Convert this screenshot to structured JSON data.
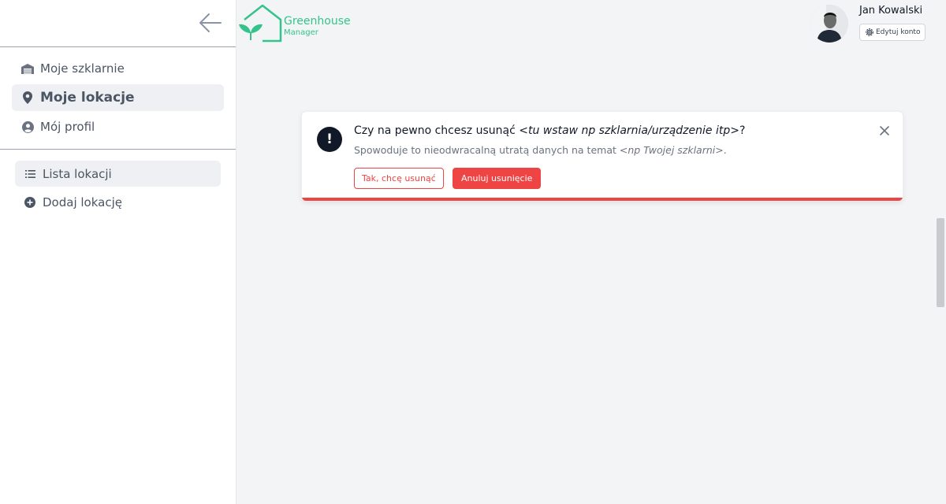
{
  "colors": {
    "brand_green": "#34c48b",
    "danger": "#ef4444",
    "sidebar_active_bg": "#eef0f4",
    "page_bg": "#f3f4f6"
  },
  "sidebar": {
    "back_icon": "arrow-left-icon",
    "main_items": [
      {
        "label": "Moje szklarnie",
        "icon": "warehouse-icon",
        "active": false
      },
      {
        "label": "Moje lokacje",
        "icon": "location-pin-icon",
        "active": true
      },
      {
        "label": "Mój profil",
        "icon": "user-circle-icon",
        "active": false
      }
    ],
    "sub_items": [
      {
        "label": "Lista lokacji",
        "icon": "list-icon",
        "active": true
      },
      {
        "label": "Dodaj lokację",
        "icon": "plus-circle-icon",
        "active": false
      }
    ]
  },
  "logo": {
    "title": "Greenhouse",
    "subtitle": "Manager"
  },
  "user": {
    "name": "Jan Kowalski",
    "edit_label": "Edytuj konto"
  },
  "dialog": {
    "title_prefix": "Czy na pewno chcesz usunąć ",
    "title_emph": "<tu wstaw np szklarnia/urządzenie itp>",
    "title_suffix": "?",
    "message_prefix": "Spowoduje to nieodwracalną utratą danych na temat ",
    "message_emph": "<np Twojej szklarni>",
    "message_suffix": ".",
    "confirm_label": "Tak, chcę usunąć",
    "cancel_label": "Anuluj usunięcie"
  }
}
